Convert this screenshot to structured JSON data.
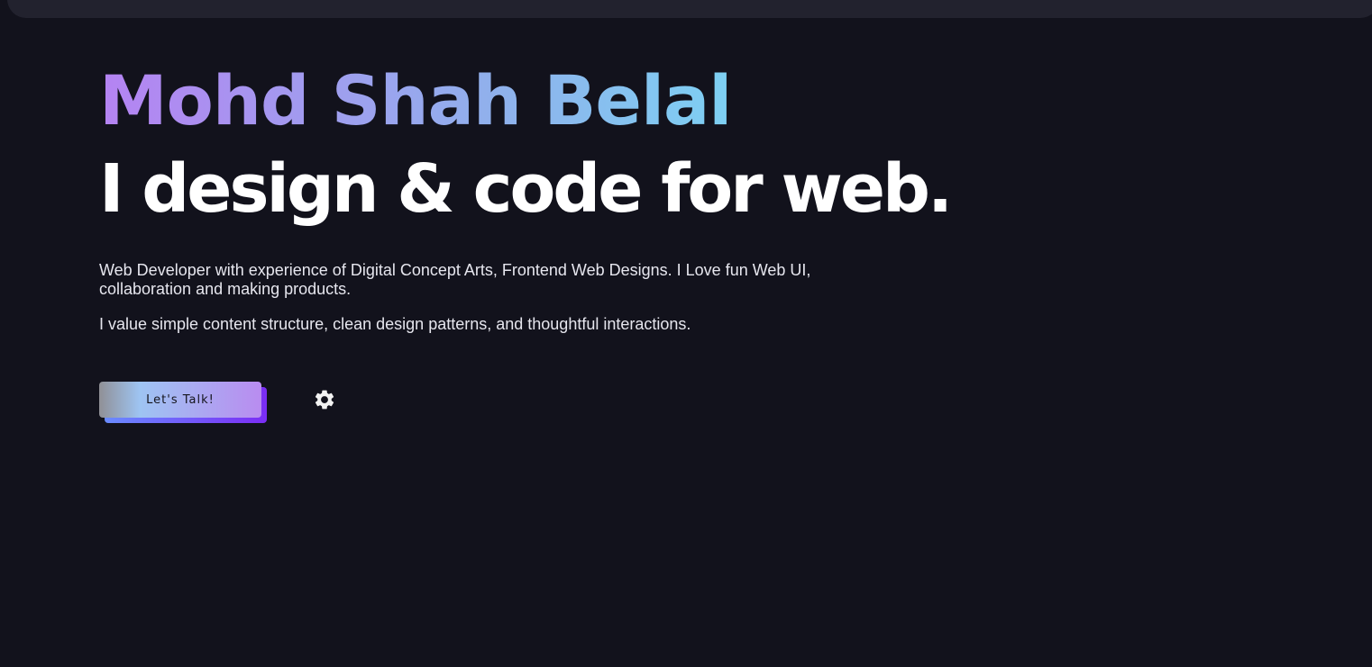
{
  "hero": {
    "name": "Mohd Shah Belal",
    "tagline": "I design & code for web."
  },
  "bio": {
    "paragraphs": [
      "Web Developer with experience of Digital Concept Arts, Frontend Web Designs. I Love fun Web UI, collaboration and making products.",
      "I value simple content structure, clean design patterns, and thoughtful interactions."
    ]
  },
  "actions": {
    "cta_label": "Let's Talk!",
    "settings_icon": "gear-icon"
  },
  "colors": {
    "background": "#12121c",
    "name_gradient_start": "#b583f2",
    "name_gradient_end": "#6fe8f8",
    "tagline": "#ffffff",
    "cta_accent": "#7b2df5"
  }
}
